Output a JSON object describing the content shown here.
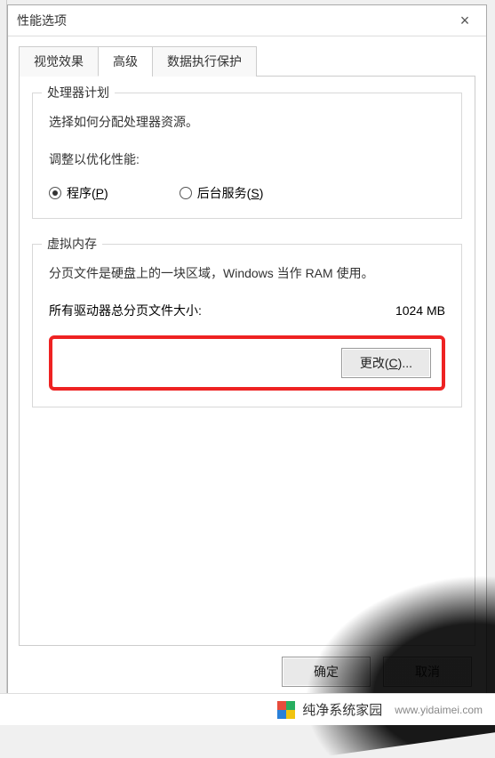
{
  "window": {
    "title": "性能选项",
    "close_icon": "×"
  },
  "tabs": [
    {
      "label": "视觉效果",
      "active": false
    },
    {
      "label": "高级",
      "active": true
    },
    {
      "label": "数据执行保护",
      "active": false
    }
  ],
  "processor_group": {
    "legend": "处理器计划",
    "desc": "选择如何分配处理器资源。",
    "adjust_label": "调整以优化性能:",
    "options": {
      "programs": {
        "text": "程序(",
        "hotkey": "P",
        "suffix": ")",
        "selected": true
      },
      "background": {
        "text": "后台服务(",
        "hotkey": "S",
        "suffix": ")",
        "selected": false
      }
    }
  },
  "vm_group": {
    "legend": "虚拟内存",
    "desc": "分页文件是硬盘上的一块区域，Windows 当作 RAM 使用。",
    "total_label": "所有驱动器总分页文件大小:",
    "total_value": "1024 MB",
    "change_button": {
      "text": "更改(",
      "hotkey": "C",
      "suffix": ")..."
    }
  },
  "footer": {
    "ok": "确定",
    "cancel": "取消"
  },
  "watermark": {
    "brand": "纯净系统家园",
    "url": "www.yidaimei.com"
  }
}
